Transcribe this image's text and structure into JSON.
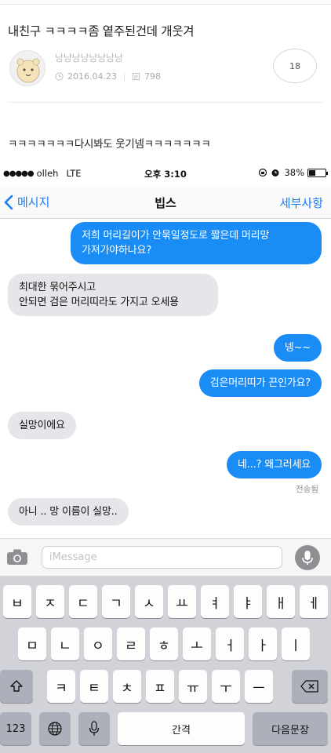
{
  "post": {
    "title": "내친구 ㅋㅋㅋㅋ좀 옅주된건데 개웃겨",
    "author": "낭낭낭낭낭낭낭낭",
    "date": "2016.04.23",
    "views": "798",
    "comments": "18",
    "body": "ㅋㅋㅋㅋㅋㅋㅋ다시봐도 웃기넴ㅋㅋㅋㅋㅋㅋㅋ"
  },
  "status_bar": {
    "signal": "●●●●●",
    "carrier": "olleh",
    "network": "LTE",
    "time": "오후 3:10",
    "battery": "38%"
  },
  "nav": {
    "back_label": "메시지",
    "title": "빕스",
    "details_label": "세부사항"
  },
  "messages": [
    {
      "side": "out",
      "line1": "저희 머리길이가 안묶일정도로 짧은데 머리망",
      "line2": "가져가야하나요?"
    },
    {
      "side": "in",
      "line1": "최대한 묶어주시고",
      "line2": "안되면 검은 머리띠라도 가지고 오세용"
    },
    {
      "side": "out",
      "line1": "넹~~"
    },
    {
      "side": "out",
      "line1": "검은머리띠가 끈인가요?"
    },
    {
      "side": "in",
      "line1": "실망이에요"
    },
    {
      "side": "out",
      "line1": "네...? 왜그러세요"
    },
    {
      "side": "in",
      "line1": "아니 .. 망 이름이 실망.."
    }
  ],
  "delivered_label": "전송됨",
  "input": {
    "placeholder": "iMessage"
  },
  "keyboard": {
    "row1": [
      "ㅂ",
      "ㅈ",
      "ㄷ",
      "ㄱ",
      "ㅅ",
      "ㅛ",
      "ㅕ",
      "ㅑ",
      "ㅐ",
      "ㅔ"
    ],
    "row2": [
      "ㅁ",
      "ㄴ",
      "ㅇ",
      "ㄹ",
      "ㅎ",
      "ㅗ",
      "ㅓ",
      "ㅏ",
      "ㅣ"
    ],
    "row3": [
      "ㅋ",
      "ㅌ",
      "ㅊ",
      "ㅍ",
      "ㅠ",
      "ㅜ",
      "ㅡ"
    ],
    "numbers_label": "123",
    "space_label": "간격",
    "next_label": "다음문장"
  },
  "colors": {
    "ios_blue": "#1a7cf5",
    "outgoing_bubble": "#1a8cf5",
    "incoming_bubble": "#e6e6ea",
    "keyboard_bg": "#d1d3d9"
  },
  "icons": {
    "avatar": "cartoon-avatar-icon",
    "date": "clock-icon",
    "views": "document-icon",
    "back": "chevron-left-icon",
    "camera": "camera-icon",
    "mic": "microphone-icon",
    "shift": "shift-icon",
    "delete": "backspace-icon",
    "globe": "globe-icon",
    "dictation": "microphone-icon"
  }
}
